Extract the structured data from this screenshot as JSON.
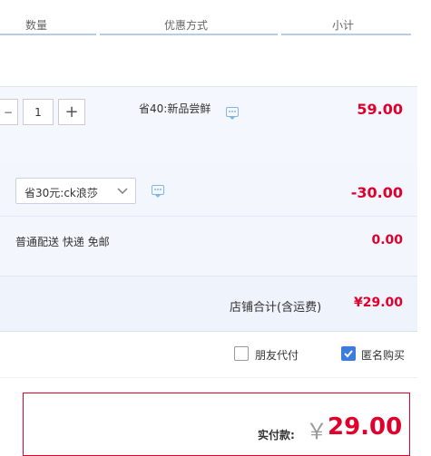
{
  "header": {
    "col_quantity": "数量",
    "col_discount": "优惠方式",
    "col_subtotal": "小计"
  },
  "product": {
    "quantity": "1",
    "minus_symbol": "−",
    "plus_symbol": "+",
    "discount_text": "省40:新品尝鲜",
    "subtotal": "59.00"
  },
  "coupon": {
    "selected": "省30元:ck浪莎",
    "amount": "-30.00"
  },
  "shipping": {
    "text": "普通配送 快递 免邮",
    "amount": "0.00"
  },
  "store_total": {
    "label": "店铺合计(含运费)",
    "amount": "¥29.00"
  },
  "options": {
    "friend_pay": "朋友代付",
    "anonymous": "匿名购买",
    "anonymous_checked": true
  },
  "payment": {
    "label": "实付款:",
    "currency": "￥",
    "amount": "29.00"
  },
  "colors": {
    "accent_red": "#e0002c",
    "checkbox_blue": "#3b7ddd"
  }
}
